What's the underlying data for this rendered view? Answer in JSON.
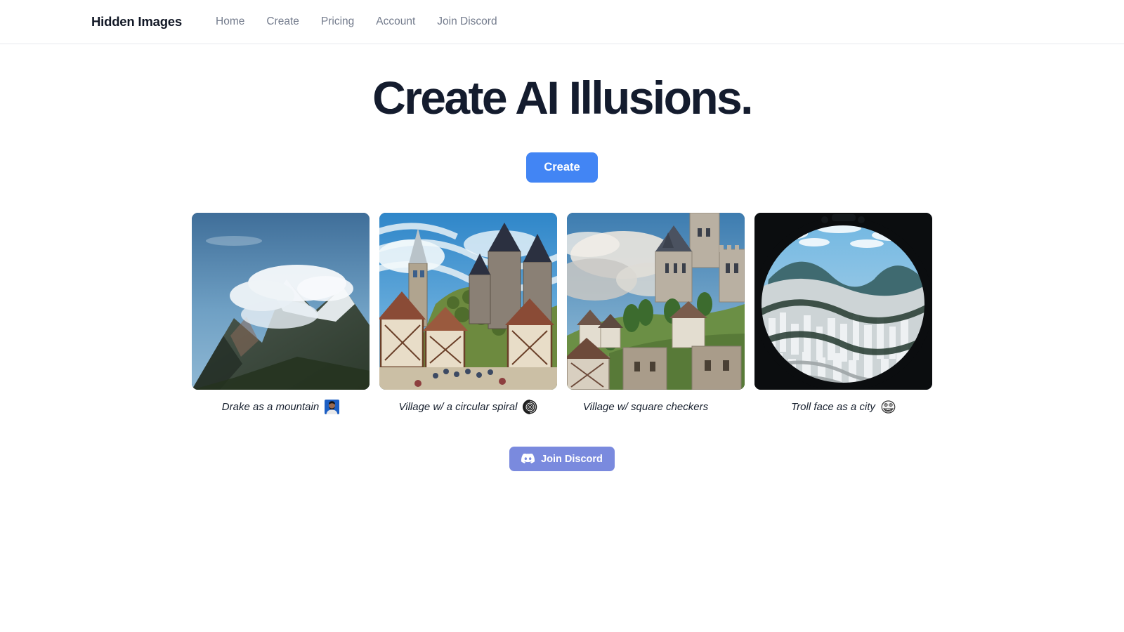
{
  "brand": {
    "name": "Hidden Images"
  },
  "nav": {
    "items": [
      {
        "label": "Home",
        "name": "nav-link-home"
      },
      {
        "label": "Create",
        "name": "nav-link-create"
      },
      {
        "label": "Pricing",
        "name": "nav-link-pricing"
      },
      {
        "label": "Account",
        "name": "nav-link-account"
      },
      {
        "label": "Join Discord",
        "name": "nav-link-join-discord"
      }
    ]
  },
  "hero": {
    "title": "Create AI Illusions.",
    "cta_label": "Create"
  },
  "gallery": {
    "items": [
      {
        "caption": "Drake as a mountain",
        "icon": "drake-portrait-icon",
        "image": "mountain-peak-with-clouds"
      },
      {
        "caption": "Village w/ a circular spiral",
        "icon": "circular-spiral-icon",
        "image": "medieval-village-illustration"
      },
      {
        "caption": "Village w/ square checkers",
        "icon": "checkerboard-icon",
        "image": "hillside-castle-village"
      },
      {
        "caption": "Troll face as a city",
        "icon": "troll-face-icon",
        "image": "aerial-city-fisheye"
      }
    ]
  },
  "footer_cta": {
    "label": "Join Discord",
    "icon": "discord-logo-icon"
  },
  "colors": {
    "accent_blue": "#4285f4",
    "discord_blurple": "#7a8ade",
    "title_navy": "#141c2e",
    "nav_link_gray": "#737b8c",
    "border_gray": "#e6e8ec"
  }
}
